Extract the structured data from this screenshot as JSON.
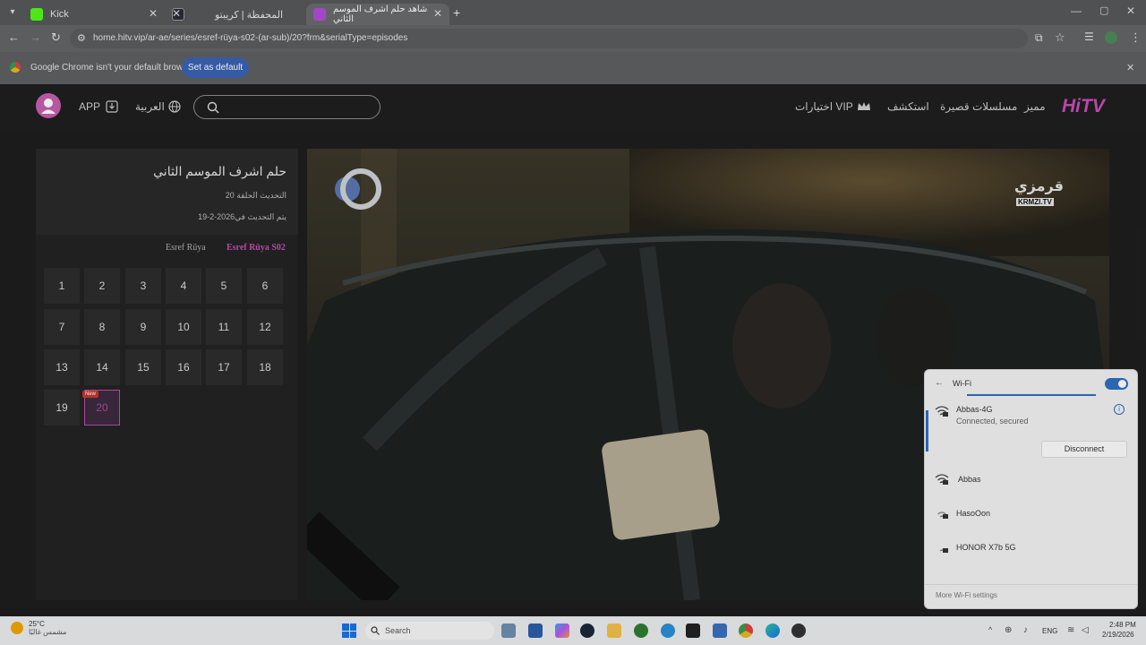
{
  "browser": {
    "tabs": [
      {
        "title": "Kick",
        "active": false,
        "favicon_color": "#53fc18"
      },
      {
        "title": "المحفظة | كريبتو",
        "active": false,
        "favicon_color": "#2c2c3a"
      },
      {
        "title": "شاهد حلم اشرف الموسم الثاني",
        "active": true,
        "favicon_color": "#b34cd8"
      }
    ],
    "url": "home.hitv.vip/ar-ae/series/esref-rüya-s02-(ar-sub)/20?frm&serialType=episodes",
    "infobar": {
      "message": "Google Chrome isn't your default browser",
      "button": "Set as default"
    }
  },
  "site": {
    "logo": "HiTV",
    "nav": [
      "مميز",
      "مسلسلات قصيرة",
      "استكشف",
      "اختيارات VIP"
    ],
    "language": "العربية",
    "app_label": "APP",
    "search_placeholder": ""
  },
  "series": {
    "title": "حلم اشرف الموسم الثاني",
    "updated_episode": "التحديث الحلقة 20",
    "updated_date": "19-2-2026يتم التحديث في",
    "season_tabs": [
      {
        "label": "Esref Rüya S02",
        "active": true
      },
      {
        "label": "Esref Rüya",
        "active": false
      }
    ],
    "episodes": [
      "1",
      "2",
      "3",
      "4",
      "5",
      "6",
      "7",
      "8",
      "9",
      "10",
      "11",
      "12",
      "13",
      "14",
      "15",
      "16",
      "17",
      "18",
      "19",
      "20"
    ],
    "current_episode": "20",
    "new_badge": "New"
  },
  "video": {
    "watermark_arabic": "قرمزي",
    "watermark_latin": "KRMZI.TV"
  },
  "wifi": {
    "title": "Wi-Fi",
    "enabled": true,
    "connected": {
      "name": "Abbas-4G",
      "status": "Connected, secured"
    },
    "disconnect_label": "Disconnect",
    "networks": [
      "Abbas",
      "HasoOon",
      "HONOR X7b 5G"
    ],
    "more_label": "More Wi-Fi settings",
    "accent": "#2f6fbf"
  },
  "taskbar": {
    "weather_temp": "25°C",
    "weather_desc": "مشمس غالبًا",
    "search_label": "Search",
    "lang": "ENG",
    "time": "2:48 PM",
    "date": "2/19/2026"
  }
}
